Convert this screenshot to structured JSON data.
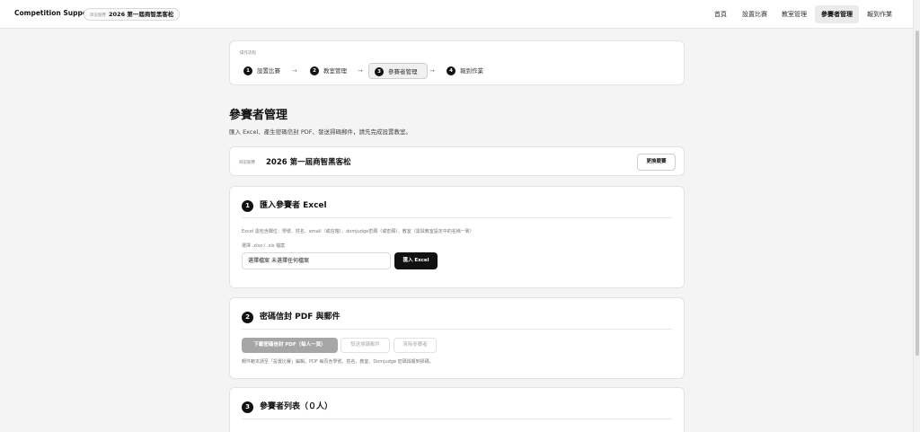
{
  "header": {
    "brand": "Competition Support",
    "current_small": "目前競賽",
    "current_name": "2026 第一屆商智黑客松",
    "nav": [
      "首頁",
      "設置比賽",
      "教室管理",
      "參賽者管理",
      "報到作業"
    ],
    "active_nav": "參賽者管理"
  },
  "steps": {
    "label": "操作流程",
    "items": [
      {
        "num": "1",
        "label": "設置比賽"
      },
      {
        "num": "2",
        "label": "教室管理"
      },
      {
        "num": "3",
        "label": "參賽者管理"
      },
      {
        "num": "4",
        "label": "報到作業"
      }
    ],
    "arrow": "→",
    "active": "3"
  },
  "page": {
    "title": "參賽者管理",
    "subtitle": "匯入 Excel、產生密碼信封 PDF、發送掃碼郵件，請先完成設置教室。"
  },
  "current_competition": {
    "label": "目前競賽",
    "name": "2026 第一屆商智黑客松",
    "switch_button": "更換競賽"
  },
  "import_section": {
    "num": "1",
    "title": "匯入參賽者 Excel",
    "hint": "Excel 需包含欄位：學號、姓名、email（或信箱）、domjudge密碼（或密碼）、教室（需與教室設定中的名稱一致）",
    "file_label": "選擇 .xlsx / .xls 檔案",
    "file_button": "選擇檔案",
    "file_status": "未選擇任何檔案",
    "import_button": "匯入 Excel"
  },
  "pdf_section": {
    "num": "2",
    "title": "密碼信封 PDF 與郵件",
    "download_button": "下載密碼信封 PDF（每人一頁）",
    "send_button": "發送掃碼郵件",
    "clear_button": "清除參賽者",
    "note": "郵件範本請至「設置比賽」編輯。PDF 每頁含學號、姓名、教室、Domjudge 密碼與報到掃碼。"
  },
  "list_section": {
    "num": "3",
    "title": "參賽者列表（０人）"
  }
}
